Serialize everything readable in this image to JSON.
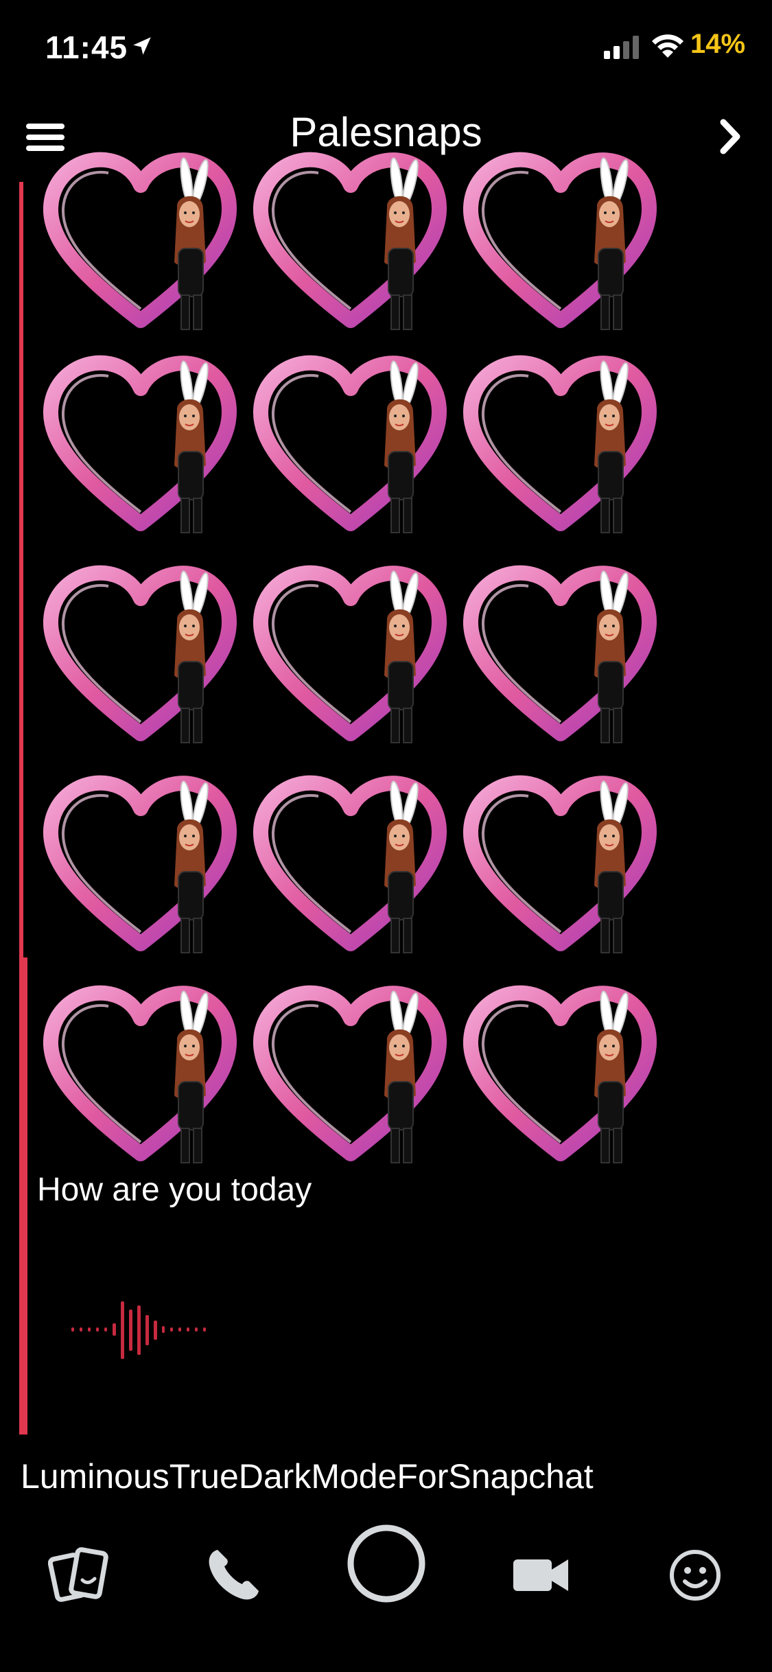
{
  "status": {
    "time": "11:45",
    "battery_percent": "14%"
  },
  "header": {
    "title": "Palesnaps"
  },
  "chat": {
    "sticker_grid": {
      "rows": 5,
      "columns": 3,
      "sticker": "heart-bunny-bitmoji"
    },
    "message": "How are you today",
    "voice_note": "voice-waveform"
  },
  "caption": "LuminousTrueDarkModeForSnapchat",
  "bottom_bar": {
    "icons": [
      "memories-icon",
      "phone-icon",
      "camera-shutter",
      "video-call-icon",
      "emoji-icon"
    ]
  },
  "colors": {
    "accent": "#e2384f",
    "battery": "#f5c518",
    "icon_gray": "#d7dadd",
    "heart": "#e05aa0"
  }
}
